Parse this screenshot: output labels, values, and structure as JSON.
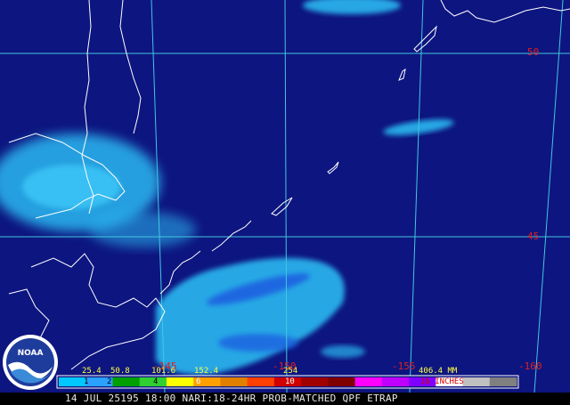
{
  "map": {
    "latitude_labels": [
      {
        "id": "lat-50",
        "text": "50"
      },
      {
        "id": "lat-45",
        "text": "45"
      }
    ],
    "longitude_labels": [
      {
        "id": "lon-145",
        "text": "-145"
      },
      {
        "id": "lon-150",
        "text": "-150"
      },
      {
        "id": "lon-155",
        "text": "-155"
      },
      {
        "id": "lon-160",
        "text": "-160"
      }
    ],
    "colors": {
      "ocean": "#0d1580",
      "graticule": "#40c8e0",
      "coastline": "#ffffff",
      "label": "#e02020",
      "precip_light": "#2ab8f0",
      "precip_medium": "#1a60e0"
    }
  },
  "legend": {
    "mm_labels": [
      "25.4",
      "50.8",
      "101.6",
      "152.4",
      "254",
      "406.4 MM"
    ],
    "inch_labels": [
      "1",
      "2",
      "4",
      "6",
      "10",
      "16 INCHES"
    ],
    "color_steps": [
      "#00c8ff",
      "#2aa0ff",
      "#00a000",
      "#30d030",
      "#ffff00",
      "#ffa000",
      "#e08000",
      "#ff4000",
      "#d00000",
      "#a00000",
      "#800000",
      "#ff00ff",
      "#c000ff",
      "#8000ff",
      "#ffffff",
      "#c0c0c0",
      "#808080"
    ]
  },
  "logo": {
    "text": "NOAA"
  },
  "caption": {
    "text": "14 JUL 25195 18:00 NARI:18-24HR PROB-MATCHED QPF ETRAP"
  }
}
